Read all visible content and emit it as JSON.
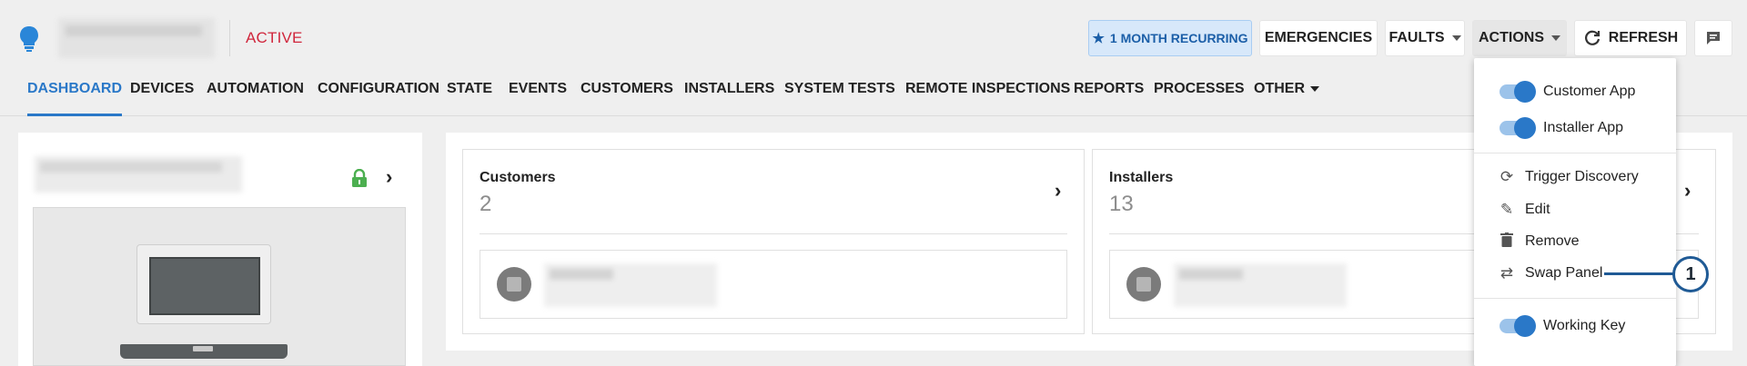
{
  "header": {
    "status": "ACTIVE",
    "buttons": {
      "recurring": "1 MONTH RECURRING",
      "emergencies": "EMERGENCIES",
      "faults": "FAULTS",
      "actions": "ACTIONS",
      "refresh": "REFRESH"
    }
  },
  "nav": {
    "tabs": [
      "DASHBOARD",
      "DEVICES",
      "AUTOMATION",
      "CONFIGURATION",
      "STATE",
      "EVENTS",
      "CUSTOMERS",
      "INSTALLERS",
      "SYSTEM TESTS",
      "REMOTE INSPECTIONS",
      "REPORTS",
      "PROCESSES",
      "OTHER"
    ],
    "active_tab": "DASHBOARD"
  },
  "cards": {
    "customers": {
      "title": "Customers",
      "count": "2"
    },
    "installers": {
      "title": "Installers",
      "count": "13"
    }
  },
  "actions_menu": {
    "toggles": [
      {
        "label": "Customer App",
        "on": true
      },
      {
        "label": "Installer App",
        "on": true
      }
    ],
    "items": [
      {
        "label": "Trigger Discovery",
        "icon": "sync-icon"
      },
      {
        "label": "Edit",
        "icon": "pencil-icon"
      },
      {
        "label": "Remove",
        "icon": "trash-icon"
      },
      {
        "label": "Swap Panel",
        "icon": "swap-icon"
      }
    ],
    "bottom_toggle": {
      "label": "Working Key",
      "on": true
    }
  },
  "callout": {
    "number": "1"
  },
  "colors": {
    "accent": "#2a78c8",
    "status_active": "#d0263c",
    "lock": "#4caf50",
    "recurring_bg": "#d7e8fa"
  }
}
